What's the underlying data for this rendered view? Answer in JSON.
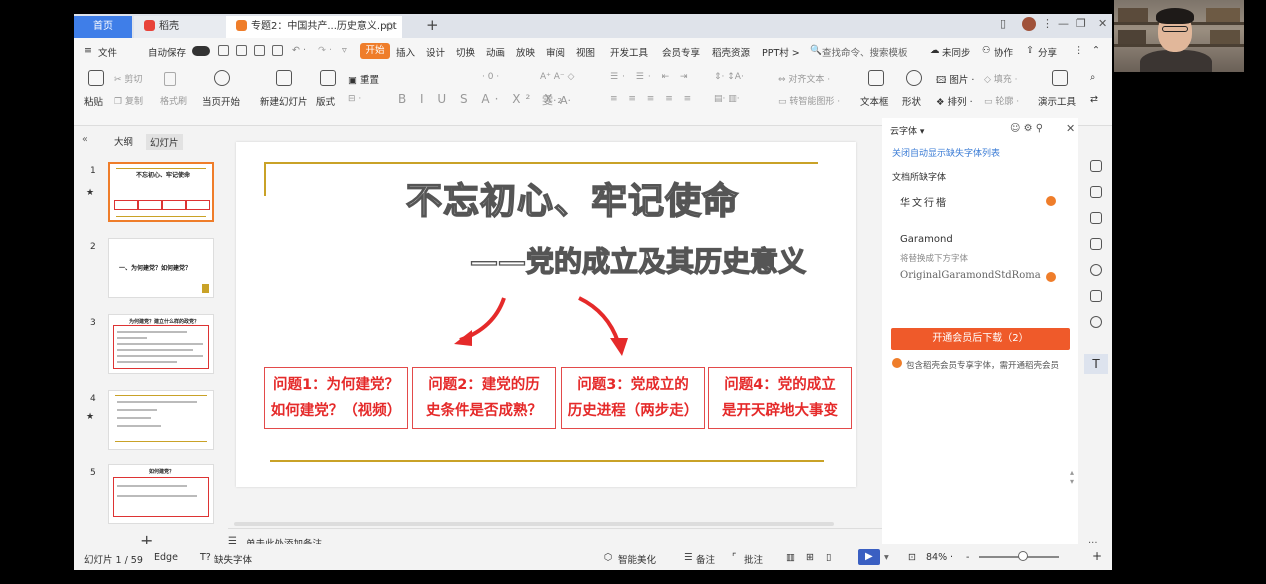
{
  "window": {
    "tabs": [
      {
        "label": "首页"
      },
      {
        "label": "稻壳"
      },
      {
        "label": "专题2：中国共产...历史意义.ppt"
      }
    ],
    "new_tab": "+"
  },
  "menu": {
    "file": "文件",
    "autosave": "自动保存",
    "start": "开始",
    "items": [
      "插入",
      "设计",
      "切换",
      "动画",
      "放映",
      "审阅",
      "视图",
      "开发工具",
      "会员专享",
      "稻壳资源",
      "PPT村 >"
    ],
    "search": "查找命令、搜索模板",
    "unsynced": "未同步",
    "collab": "协作",
    "share": "分享"
  },
  "ribbon": {
    "paste": "粘贴",
    "cut": "剪切",
    "copy": "复制",
    "format_painter": "格式刷",
    "from_current": "当页开始",
    "new_slide": "新建幻灯片",
    "layout": "版式",
    "reset": "重置",
    "text_direction": "对齐文本",
    "smart_graphic": "转智能图形",
    "textbox": "文本框",
    "shape": "形状",
    "arrange": "排列",
    "picture": "图片",
    "fill": "填充",
    "outline": "轮廓",
    "presentation_tools": "演示工具"
  },
  "left_panel": {
    "outline_tab": "大纲",
    "slides_tab": "幻灯片",
    "slides": [
      {
        "num": "1",
        "star": true,
        "title": "不忘初心、牢记使命"
      },
      {
        "num": "2",
        "star": false,
        "title": "一、为何建党？如何建党？"
      },
      {
        "num": "3",
        "star": false,
        "title": "为何建党？建立什么样的政党？"
      },
      {
        "num": "4",
        "star": true,
        "title": ""
      },
      {
        "num": "5",
        "star": false,
        "title": "如何建党？"
      }
    ],
    "add": "+"
  },
  "slide": {
    "title": "不忘初心、牢记使命",
    "subtitle": "——党的成立及其历史意义",
    "questions": [
      {
        "line1": "问题1：为何建党？",
        "line2": "如何建党？（视频）"
      },
      {
        "line1": "问题2：建党的历",
        "line2": "史条件是否成熟？"
      },
      {
        "line1": "问题3：党成立的",
        "line2": "历史进程（两步走）"
      },
      {
        "line1": "问题4：党的成立",
        "line2": "是开天辟地大事变"
      }
    ],
    "notes_placeholder": "单击此处添加备注"
  },
  "font_panel": {
    "header": "云字体",
    "auto_show_link": "关闭自动显示缺失字体列表",
    "missing_label": "文档所缺字体",
    "font1": "华文行楷",
    "font2": "Garamond",
    "font2_replace": "将替换成下方字体",
    "font3": "OriginalGaramondStdRoma",
    "download_button": "开通会员后下载（2）",
    "member_note": "包含稻壳会员专享字体，需开通稻壳会员"
  },
  "statusbar": {
    "slide_counter": "幻灯片 1 / 59",
    "theme": "Edge",
    "missing_fonts": "缺失字体",
    "smart_beautify": "智能美化",
    "notes": "备注",
    "comments": "批注",
    "zoom": "84%",
    "zoom_plus": "+",
    "zoom_minus": "-"
  },
  "colors": {
    "accent_orange": "#ef7d2a",
    "download_red": "#ef5a2a",
    "question_red": "#e52a2a",
    "gold_line": "#c9a227",
    "home_tab_blue": "#3f7ee8"
  }
}
